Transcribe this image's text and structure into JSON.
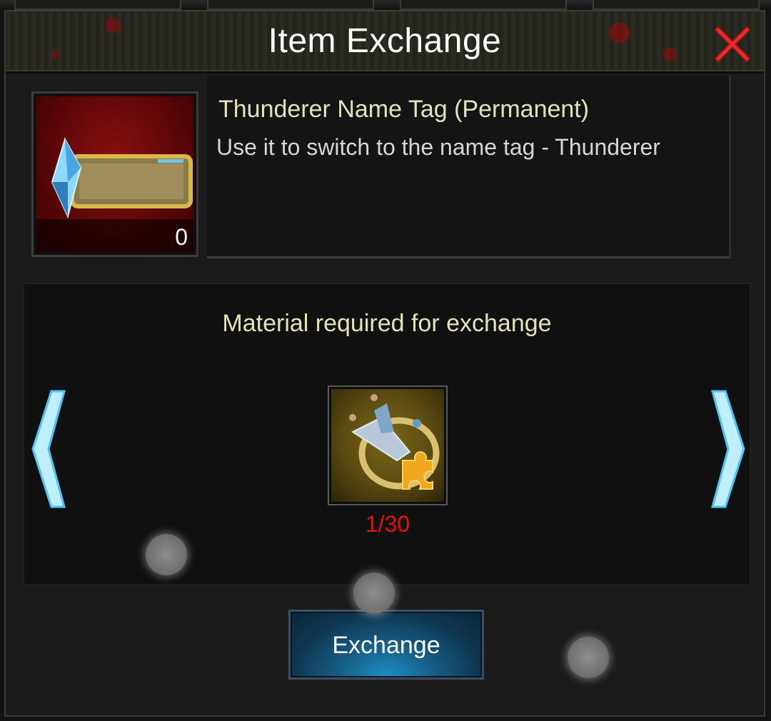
{
  "dialog": {
    "title": "Item Exchange",
    "close_icon": "close-x-icon",
    "accent_red": "#d62020"
  },
  "item": {
    "name": "Thunderer Name Tag (Permanent)",
    "description": "Use it to switch to the name tag - Thunderer",
    "owned_count": "0",
    "icon": "name-tag-crystal-icon"
  },
  "materials": {
    "heading": "Material required for exchange",
    "current": {
      "icon": "weapon-fragment-puzzle-icon",
      "progress": "1/30",
      "progress_color": "#e01414"
    },
    "prev_icon": "chevron-left-icon",
    "next_icon": "chevron-right-icon"
  },
  "actions": {
    "exchange_label": "Exchange"
  }
}
